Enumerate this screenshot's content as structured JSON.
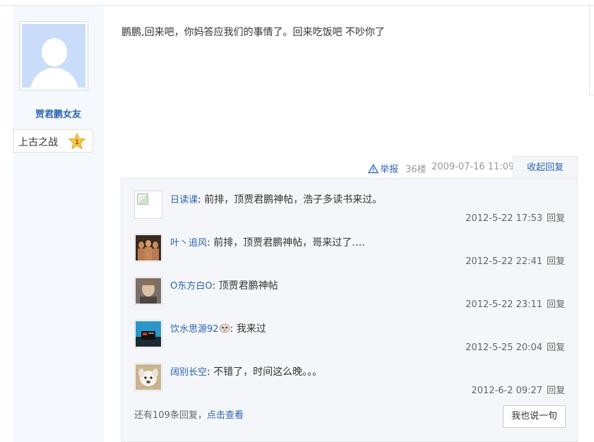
{
  "author": {
    "name": "贾君鹏女友",
    "rank_title": "上古之战",
    "rank_level": "1"
  },
  "post": {
    "text": "鹏鹏,回来吧，你妈答应我们的事情了。回来吃饭吧 不吵你了",
    "report_label": "举报",
    "floor": "36楼",
    "time": "2009-07-16 11:09",
    "collapse_label": "收起回复"
  },
  "replies": [
    {
      "user": "日读课",
      "text": "前排，顶贾君鹏神帖，浩子多读书来过。",
      "time": "2012-5-22 17:53",
      "reply_label": "回复",
      "avatar": "broken-image"
    },
    {
      "user": "叶丶追风",
      "text": "前排，顶贾君鹏神帖，哥来过了….",
      "time": "2012-5-22 22:41",
      "reply_label": "回复",
      "avatar": "group-photo"
    },
    {
      "user": "O东方白O",
      "text": "顶贾君鹏神帖",
      "time": "2012-5-22 23:11",
      "reply_label": "回复",
      "avatar": "portrait-photo"
    },
    {
      "user": "饮水思源92",
      "text": "我来过",
      "time": "2012-5-25 20:04",
      "reply_label": "回复",
      "avatar": "device-photo"
    },
    {
      "user": "阔别长空",
      "text": "不错了，时间这么晚。。。",
      "time": "2012-6-2 09:27",
      "reply_label": "回复",
      "avatar": "sheep-photo"
    }
  ],
  "footer": {
    "more_prefix": "还有109条回复，",
    "more_link": "点击查看",
    "say_button": "我也说一句"
  },
  "colors": {
    "link": "#2d64b3",
    "sidebar_bg": "#f5f8fc",
    "reply_bg": "#f4f6f9"
  }
}
